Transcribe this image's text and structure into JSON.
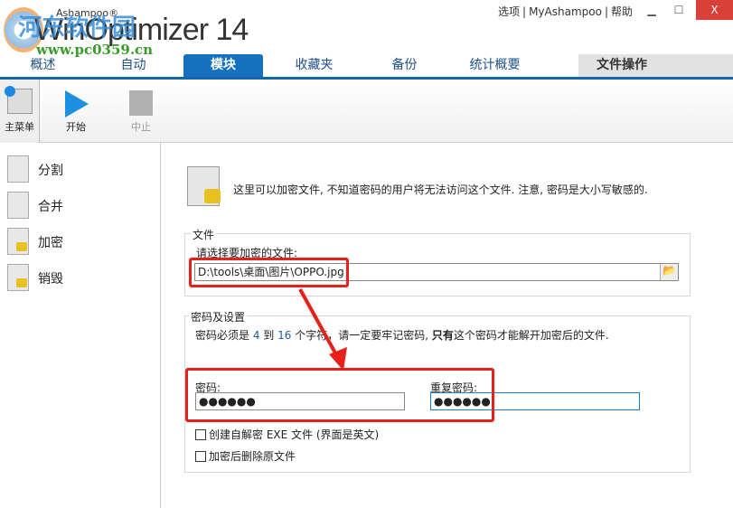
{
  "app": {
    "brand": "Ashampoo®",
    "product": "WinOptimizer 14",
    "watermark_cn": "河东软件园",
    "watermark_url": "www.pc0359.cn"
  },
  "toplinks": [
    "选项",
    "MyAshampoo",
    "帮助"
  ],
  "window": {
    "minimize": "▁",
    "maximize": "☐",
    "close": "X"
  },
  "tabs": [
    "概述",
    "自动",
    "模块",
    "收藏夹",
    "备份",
    "统计概要"
  ],
  "active_tab": "模块",
  "right_tab": "文件操作",
  "toolbar": {
    "home": "主菜单",
    "start": "开始",
    "stop": "中止"
  },
  "sidebar": [
    "分割",
    "合并",
    "加密",
    "销毁"
  ],
  "main": {
    "intro": "这里可以加密文件, 不知道密码的用户将无法访问这个文件. 注意, 密码是大小写敏感的.",
    "file_group": "文件",
    "file_label": "请选择要加密的文件:",
    "file_value": "D:\\tools\\桌面\\图片\\OPPO.jpg",
    "pw_group": "密码及设置",
    "pw_note_a": "密码必须是 ",
    "pw_min": "4",
    "pw_note_b": " 到 ",
    "pw_max": "16",
    "pw_note_c": " 个字符，请一定要牢记密码, ",
    "pw_note_bold": "只有",
    "pw_note_d": "这个密码才能解开加密后的文件.",
    "pw_label": "密码:",
    "pw_value": "●●●●●●",
    "pw2_label": "重复密码:",
    "pw2_value": "●●●●●●",
    "cb1": "创建自解密 EXE 文件 (界面是英文)",
    "cb2": "加密后删除原文件"
  }
}
